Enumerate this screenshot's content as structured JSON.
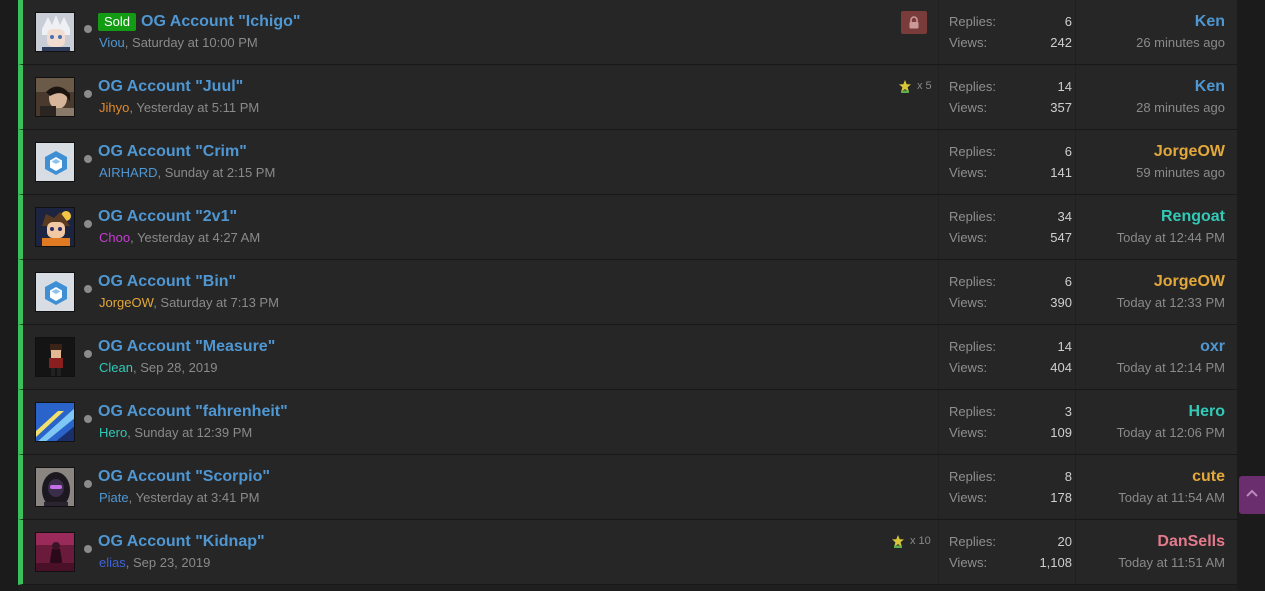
{
  "threads": [
    {
      "sold_label": "Sold",
      "title": "OG Account \"Ichigo\"",
      "author": "Viou",
      "author_color": "#4f97d3",
      "date": ", Saturday at 10:00 PM",
      "locked": true,
      "replies_label": "Replies:",
      "replies": "6",
      "views_label": "Views:",
      "views": "242",
      "last_user": "Ken",
      "last_user_color": "#4f97d3",
      "last_time": "26 minutes ago",
      "avatar_icon": "silver-hair-avatar-icon"
    },
    {
      "title": "OG Account \"Juul\"",
      "author": "Jihyo",
      "author_color": "#e08a2e",
      "date": ", Yesterday at 5:11 PM",
      "rating_count": "x 5",
      "replies_label": "Replies:",
      "replies": "14",
      "views_label": "Views:",
      "views": "357",
      "last_user": "Ken",
      "last_user_color": "#4f97d3",
      "last_time": "28 minutes ago",
      "avatar_icon": "photo-avatar-icon"
    },
    {
      "title": "OG Account \"Crim\"",
      "author": "AIRHARD",
      "author_color": "#4f97d3",
      "date": ", Sunday at 2:15 PM",
      "replies_label": "Replies:",
      "replies": "6",
      "views_label": "Views:",
      "views": "141",
      "last_user": "JorgeOW",
      "last_user_color": "#e3a83b",
      "last_time": "59 minutes ago",
      "avatar_icon": "cube-avatar-icon"
    },
    {
      "title": "OG Account \"2v1\"",
      "author": "Choo",
      "author_color": "#c33fd1",
      "date": ", Yesterday at 4:27 AM",
      "replies_label": "Replies:",
      "replies": "34",
      "views_label": "Views:",
      "views": "547",
      "last_user": "Rengoat",
      "last_user_color": "#32c9b6",
      "last_time": "Today at 12:44 PM",
      "avatar_icon": "anime-avatar-icon"
    },
    {
      "title": "OG Account \"Bin\"",
      "author": "JorgeOW",
      "author_color": "#e3a83b",
      "date": ", Saturday at 7:13 PM",
      "replies_label": "Replies:",
      "replies": "6",
      "views_label": "Views:",
      "views": "390",
      "last_user": "JorgeOW",
      "last_user_color": "#e3a83b",
      "last_time": "Today at 12:33 PM",
      "avatar_icon": "cube-avatar-icon"
    },
    {
      "title": "OG Account \"Measure\"",
      "author": "Clean",
      "author_color": "#32c9b6",
      "date": ", Sep 28, 2019",
      "replies_label": "Replies:",
      "replies": "14",
      "views_label": "Views:",
      "views": "404",
      "last_user": "oxr",
      "last_user_color": "#4f97d3",
      "last_time": "Today at 12:14 PM",
      "avatar_icon": "pixel-character-avatar-icon"
    },
    {
      "title": "OG Account \"fahrenheit\"",
      "author": "Hero",
      "author_color": "#32c9b6",
      "date": ", Sunday at 12:39 PM",
      "replies_label": "Replies:",
      "replies": "3",
      "views_label": "Views:",
      "views": "109",
      "last_user": "Hero",
      "last_user_color": "#32c9b6",
      "last_time": "Today at 12:06 PM",
      "avatar_icon": "blue-streak-avatar-icon"
    },
    {
      "title": "OG Account \"Scorpio\"",
      "author": "Piate",
      "author_color": "#4f97d3",
      "date": ", Yesterday at 3:41 PM",
      "replies_label": "Replies:",
      "replies": "8",
      "views_label": "Views:",
      "views": "178",
      "last_user": "cute",
      "last_user_color": "#e3a83b",
      "last_time": "Today at 11:54 AM",
      "avatar_icon": "glowing-eyes-avatar-icon"
    },
    {
      "title": "OG Account \"Kidnap\"",
      "author": "elias",
      "author_color": "#3d63d6",
      "date": ", Sep 23, 2019",
      "rating_count": "x 10",
      "replies_label": "Replies:",
      "replies": "20",
      "views_label": "Views:",
      "views": "1,108",
      "last_user": "DanSells",
      "last_user_color": "#e57a8d",
      "last_time": "Today at 11:51 AM",
      "avatar_icon": "red-room-avatar-icon"
    }
  ],
  "icons": {
    "lock": "lock-icon",
    "rating": "star-award-icon",
    "scroll_top": "chevron-up-icon"
  },
  "colors": {
    "unread_bar": "#3bbf5c",
    "title_link": "#4f97d3",
    "sold_badge": "#139b13",
    "locked_badge": "#7a3b3b",
    "scroll_button": "#6a2d6e"
  }
}
